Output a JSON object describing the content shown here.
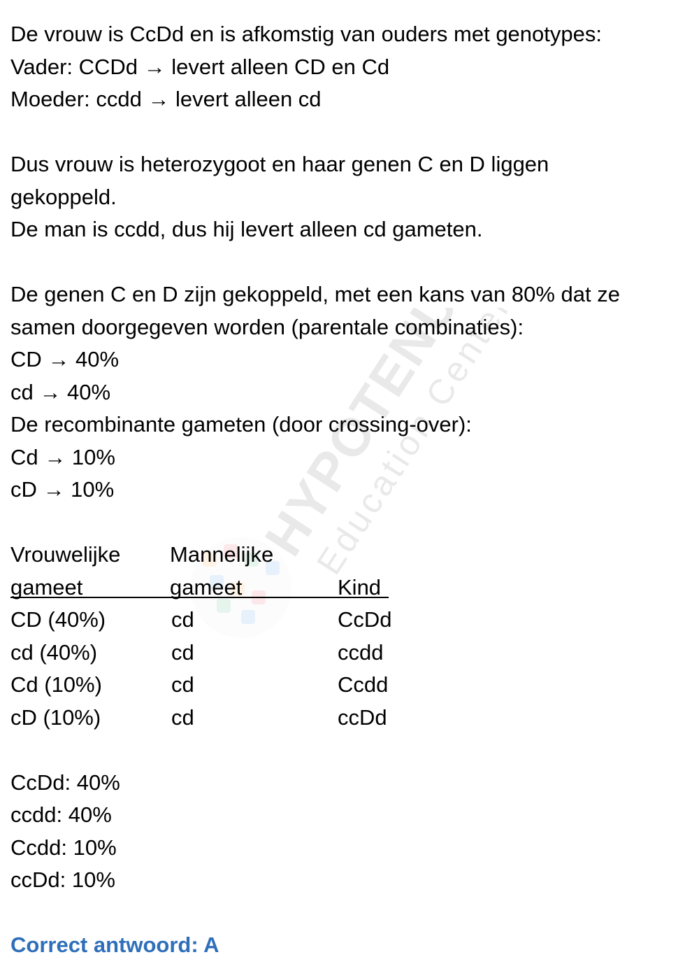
{
  "intro": {
    "line1": "De vrouw is CcDd en is afkomstig van ouders met genotypes:",
    "line2": "Vader: CCDd → levert alleen CD en Cd",
    "line3": "Moeder: ccdd → levert alleen cd"
  },
  "heterozygous": {
    "paragraph": "Dus vrouw is heterozygoot en haar genen C en D liggen gekoppeld.",
    "man_line": "De man is ccdd, dus hij levert alleen cd gameten."
  },
  "linkage": {
    "paragraph": "De genen C en D zijn gekoppeld, met een kans van 80% dat ze samen doorgegeven worden (parentale combinaties):",
    "parental": [
      "CD → 40%",
      "cd → 40%"
    ],
    "recombinant_heading": "De recombinante gameten (door crossing-over):",
    "recombinant": [
      "Cd → 10%",
      "cD → 10%"
    ]
  },
  "table": {
    "headers": {
      "female_line1": "Vrouwelijke",
      "female_line2": "gameet",
      "male_line1": "Mannelijke",
      "male_line2": "gameet",
      "child": "Kind"
    },
    "rows": [
      {
        "female": "CD (40%)",
        "male": "cd",
        "child": "CcDd"
      },
      {
        "female": "cd (40%)",
        "male": "cd",
        "child": "ccdd"
      },
      {
        "female": "Cd (10%)",
        "male": "cd",
        "child": "Ccdd"
      },
      {
        "female": "cD (10%)",
        "male": "cd",
        "child": "ccDd"
      }
    ]
  },
  "results": [
    "CcDd: 40%",
    "ccdd: 40%",
    "Ccdd: 10%",
    "ccDd: 10%"
  ],
  "answer": "Correct antwoord: A",
  "watermark": {
    "brand": "HYPOTENUSE",
    "tagline": "Education Center"
  },
  "colors": {
    "answer": "#2f6fba",
    "text": "#000000"
  }
}
